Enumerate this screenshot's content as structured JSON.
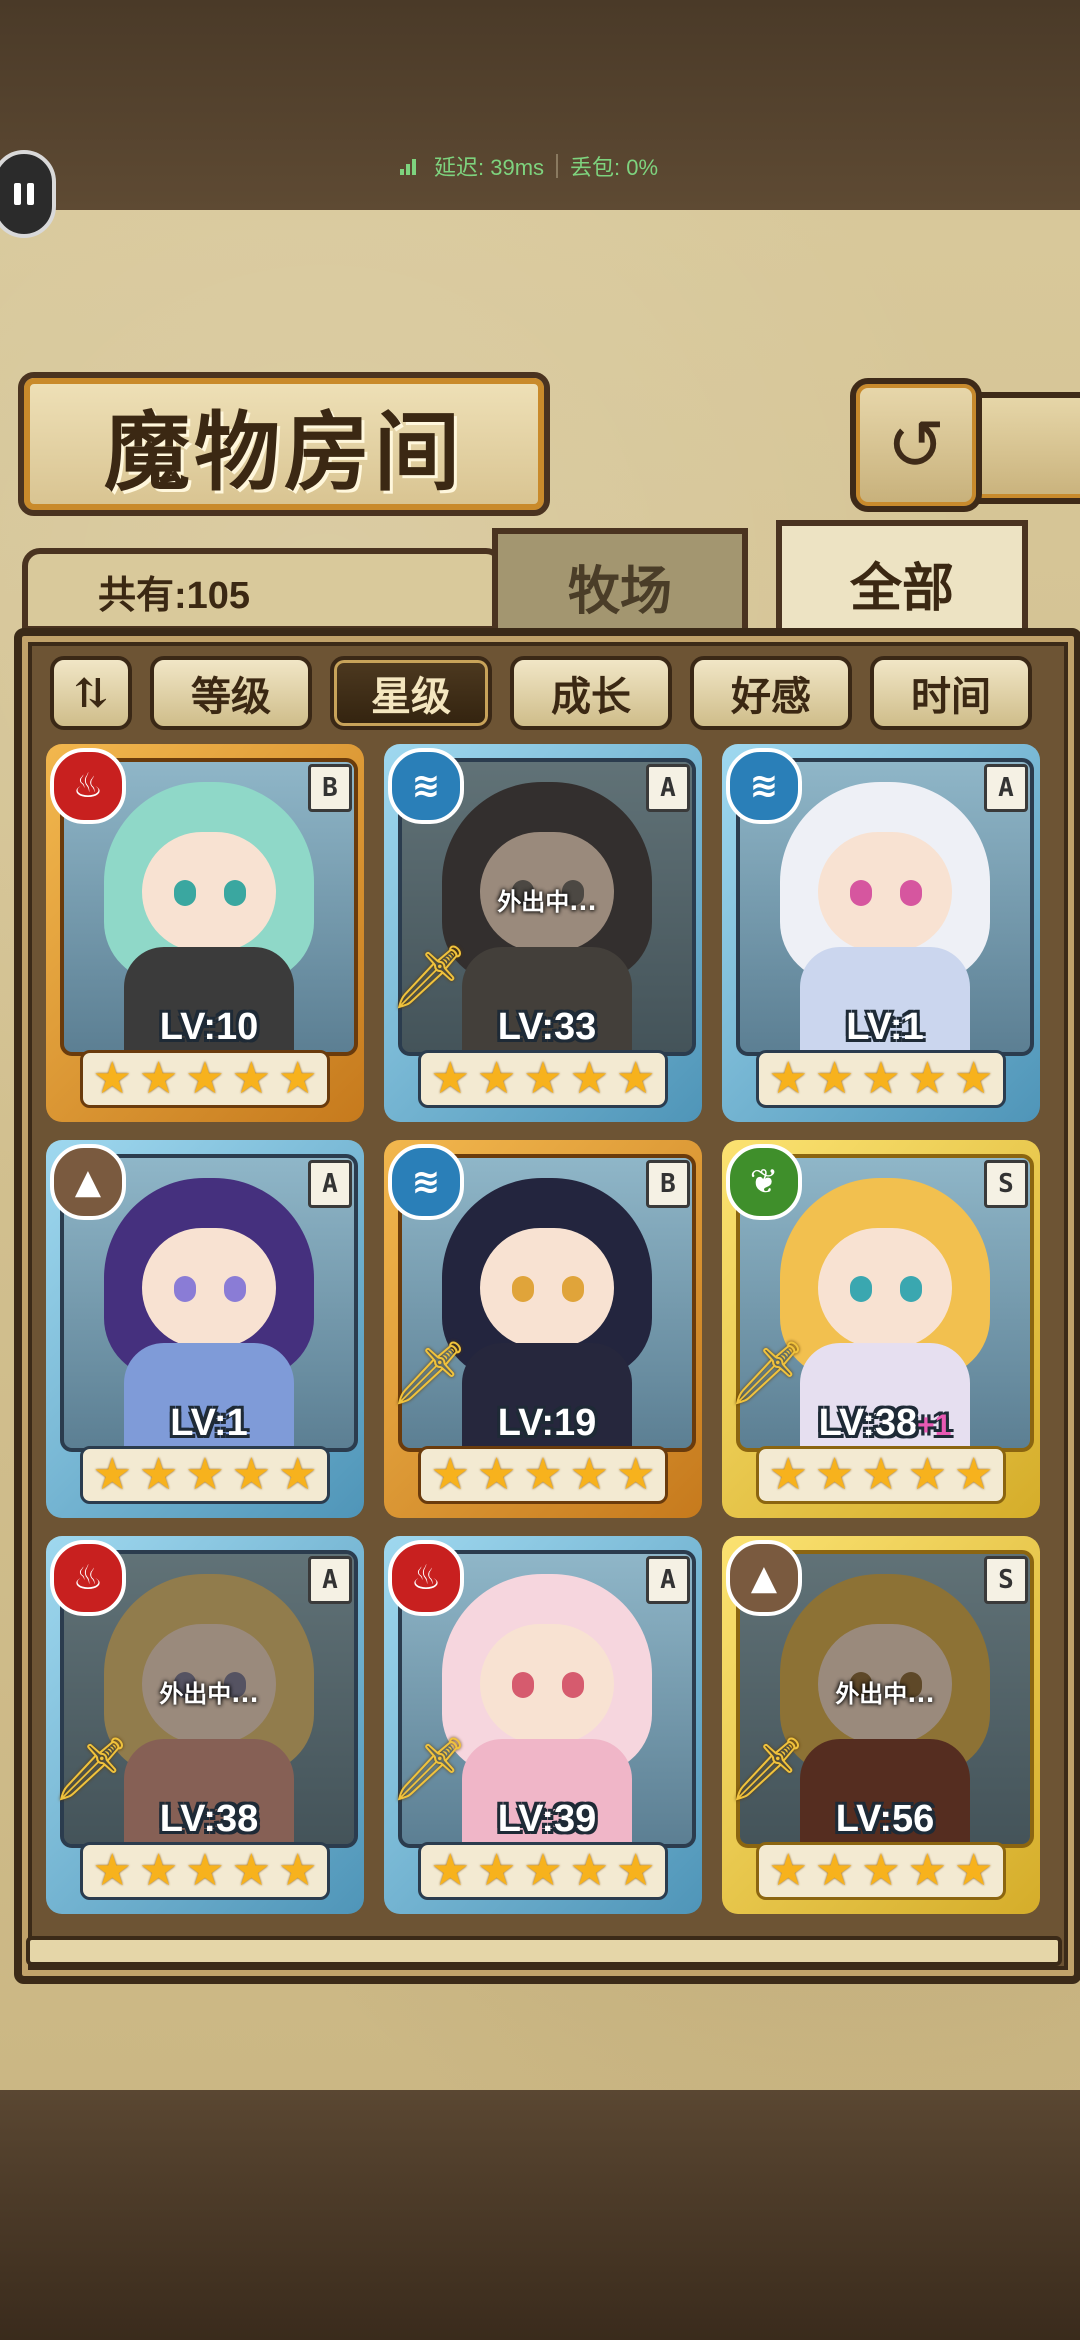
{
  "status": {
    "latency_label": "延迟: 39ms",
    "loss_label": "丢包: 0%"
  },
  "header": {
    "title": "魔物房间",
    "back_icon": "back-return-icon"
  },
  "inventory": {
    "count_label": "共有:105"
  },
  "tabs": [
    {
      "label": "牧场",
      "active": false
    },
    {
      "label": "全部",
      "active": true
    }
  ],
  "filters": {
    "sort_icon": "sort-order-icon",
    "sort_glyph": "⇅",
    "options": [
      {
        "label": "等级",
        "active": false
      },
      {
        "label": "星级",
        "active": true
      },
      {
        "label": "成长",
        "active": false
      },
      {
        "label": "好感",
        "active": false
      },
      {
        "label": "时间",
        "active": false
      }
    ]
  },
  "monsters": [
    {
      "element": "fire",
      "rank": "B",
      "level": "LV:10",
      "bonus": "",
      "stars": 5,
      "frame": "gold",
      "weapon": false,
      "away": false,
      "hair": "#8fd8c8",
      "eyes": "#3aa7a0",
      "outfit": "#3b3b3b"
    },
    {
      "element": "water",
      "rank": "A",
      "level": "LV:33",
      "bonus": "",
      "stars": 5,
      "frame": "blue",
      "weapon": true,
      "away": true,
      "hair": "#3d3d44",
      "eyes": "#6b6b6b",
      "outfit": "#5a5a5a"
    },
    {
      "element": "water",
      "rank": "A",
      "level": "LV:1",
      "bonus": "",
      "stars": 5,
      "frame": "blue",
      "weapon": false,
      "away": false,
      "hair": "#eef0f6",
      "eyes": "#d6569f",
      "outfit": "#cbd6ee"
    },
    {
      "element": "earth",
      "rank": "A",
      "level": "LV:1",
      "bonus": "",
      "stars": 5,
      "frame": "blue",
      "weapon": false,
      "away": false,
      "hair": "#45307e",
      "eyes": "#8a7cd6",
      "outfit": "#7f9bd8"
    },
    {
      "element": "water",
      "rank": "B",
      "level": "LV:19",
      "bonus": "",
      "stars": 5,
      "frame": "gold",
      "weapon": true,
      "away": false,
      "hair": "#23253e",
      "eyes": "#e0a43a",
      "outfit": "#26273d"
    },
    {
      "element": "nature",
      "rank": "S",
      "level": "LV:38",
      "bonus": "+1",
      "stars": 5,
      "frame": "yellow",
      "weapon": true,
      "away": false,
      "hair": "#f2c04f",
      "eyes": "#3aa7b0",
      "outfit": "#e6dff0"
    },
    {
      "element": "fire",
      "rank": "A",
      "level": "LV:38",
      "bonus": "",
      "stars": 5,
      "frame": "blue",
      "weapon": true,
      "away": true,
      "hair": "#e8c87a",
      "eyes": "#7b7fa3",
      "outfit": "#d4958a"
    },
    {
      "element": "fire",
      "rank": "A",
      "level": "LV:39",
      "bonus": "",
      "stars": 5,
      "frame": "blue",
      "weapon": true,
      "away": false,
      "hair": "#f6d6de",
      "eyes": "#d65b6e",
      "outfit": "#f0b6c8"
    },
    {
      "element": "earth",
      "rank": "S",
      "level": "LV:56",
      "bonus": "",
      "stars": 5,
      "frame": "yellow",
      "weapon": true,
      "away": true,
      "hair": "#e0b651",
      "eyes": "#8a6a3a",
      "outfit": "#7a3a2a"
    }
  ],
  "away_label": "外出中...",
  "element_icons": {
    "fire": "fire-element-icon",
    "water": "water-element-icon",
    "earth": "earth-element-icon",
    "nature": "nature-element-icon"
  },
  "element_glyphs": {
    "fire": "♨",
    "water": "≋",
    "earth": "▲",
    "nature": "❦"
  }
}
